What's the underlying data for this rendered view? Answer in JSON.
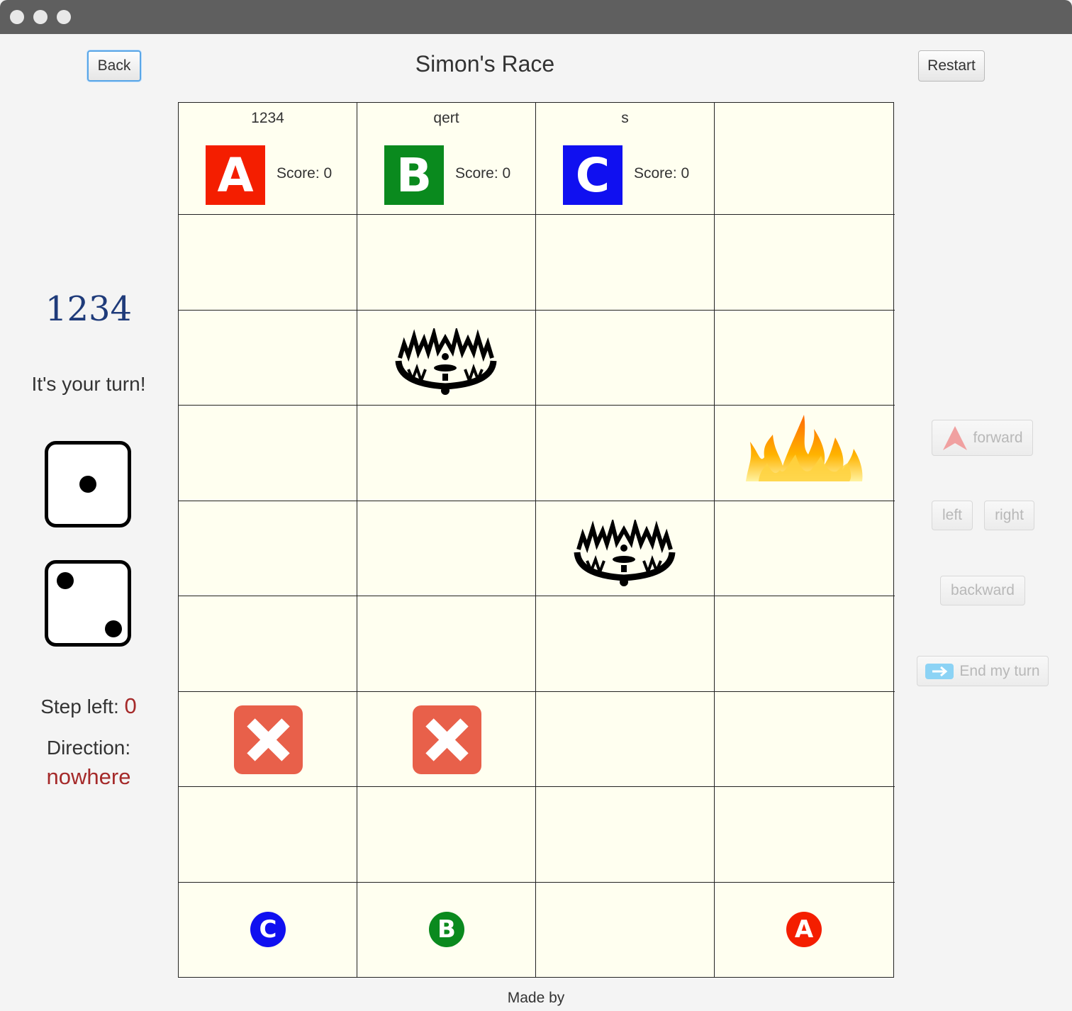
{
  "window": {
    "title": "Simon's Race"
  },
  "header": {
    "back_label": "Back",
    "restart_label": "Restart"
  },
  "players": [
    {
      "name": "1234",
      "letter": "A",
      "score_label": "Score: 0",
      "color": "#f41e00"
    },
    {
      "name": "qert",
      "letter": "B",
      "score_label": "Score: 0",
      "color": "#0a8a1e"
    },
    {
      "name": "s",
      "letter": "C",
      "score_label": "Score: 0",
      "color": "#1010f0"
    }
  ],
  "board": {
    "columns": 4,
    "rows": 8,
    "hazards": [
      {
        "type": "bear-trap",
        "row": 1,
        "col": 1
      },
      {
        "type": "fire",
        "row": 2,
        "col": 3
      },
      {
        "type": "bear-trap",
        "row": 3,
        "col": 2
      },
      {
        "type": "blocked",
        "row": 5,
        "col": 0
      },
      {
        "type": "blocked",
        "row": 5,
        "col": 1
      }
    ],
    "tokens": [
      {
        "letter": "C",
        "col": 0,
        "color": "#1010f0"
      },
      {
        "letter": "B",
        "col": 1,
        "color": "#0a8a1e"
      },
      {
        "letter": "A",
        "col": 3,
        "color": "#f41e00"
      }
    ]
  },
  "status": {
    "current_player": "1234",
    "turn_message": "It's your turn!",
    "dice": [
      1,
      2
    ],
    "steps_label": "Step left:",
    "steps_value": "0",
    "direction_label": "Direction:",
    "direction_value": "nowhere",
    "accent_color": "#a52a2a",
    "name_color": "#1f3b7a"
  },
  "controls": {
    "forward_label": "forward",
    "left_label": "left",
    "right_label": "right",
    "backward_label": "backward",
    "end_turn_label": "End my turn"
  },
  "footer": {
    "made_by_label": "Made by"
  }
}
